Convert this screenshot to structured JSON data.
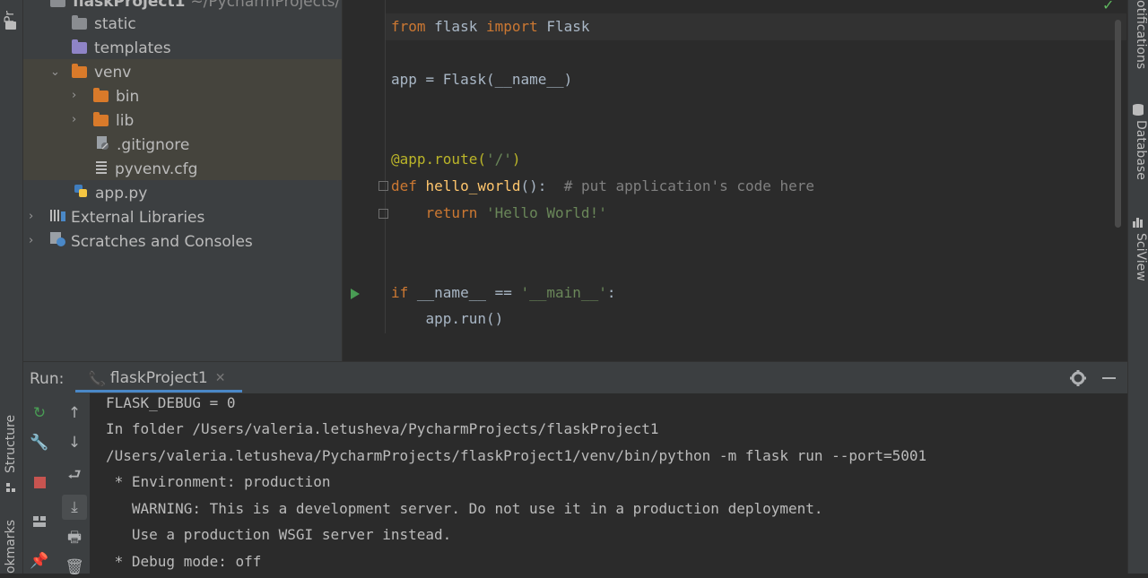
{
  "left_strip": {
    "project_label": "Pr",
    "structure_label": "Structure",
    "bookmarks_label": "okmarks"
  },
  "project": {
    "root": {
      "name": "flaskProject1",
      "path": "~/PycharmProjects/"
    },
    "items": [
      {
        "name": "static",
        "kind": "folder-grey"
      },
      {
        "name": "templates",
        "kind": "folder-purple"
      },
      {
        "name": "venv",
        "kind": "folder-orange"
      },
      {
        "name": "bin",
        "kind": "folder-orange"
      },
      {
        "name": "lib",
        "kind": "folder-orange"
      },
      {
        "name": ".gitignore",
        "kind": "file-ignore"
      },
      {
        "name": "pyvenv.cfg",
        "kind": "file-config"
      },
      {
        "name": "app.py",
        "kind": "file-python"
      },
      {
        "name": "External Libraries",
        "kind": "libraries"
      },
      {
        "name": "Scratches and Consoles",
        "kind": "scratches"
      }
    ]
  },
  "editor": {
    "line1": {
      "k1": "from",
      "m": " flask ",
      "k2": "import",
      "c": " Flask"
    },
    "line2": "app = Flask(__name__)",
    "line3": {
      "dec": "@app.route(",
      "str": "'/'",
      "end": ")"
    },
    "line4": {
      "kw": "def",
      "fn": "hello_world",
      "mid": "():  ",
      "cm": "# put application's code here"
    },
    "line5": {
      "kw": "return",
      "str": "'Hello World!'"
    },
    "line6": {
      "kw": "if",
      "mid": " __name__ == ",
      "str": "'__main__'",
      "end": ":"
    },
    "line7": "app.run()"
  },
  "right_strip": {
    "notifications_label": "otifications",
    "database_label": "Database",
    "sciview_label": "SciView"
  },
  "run": {
    "label": "Run:",
    "tab_name": "flaskProject1",
    "console_lines": [
      "FLASK_DEBUG = 0",
      "In folder /Users/valeria.letusheva/PycharmProjects/flaskProject1",
      "/Users/valeria.letusheva/PycharmProjects/flaskProject1/venv/bin/python -m flask run --port=5001",
      " * Environment: production",
      "   WARNING: This is a development server. Do not use it in a production deployment.",
      "   Use a production WSGI server instead.",
      " * Debug mode: off"
    ]
  },
  "colors": {
    "accent": "#4a88c7",
    "run_green": "#499c54",
    "stop_red": "#c75450",
    "check_green": "#5fb85f"
  }
}
